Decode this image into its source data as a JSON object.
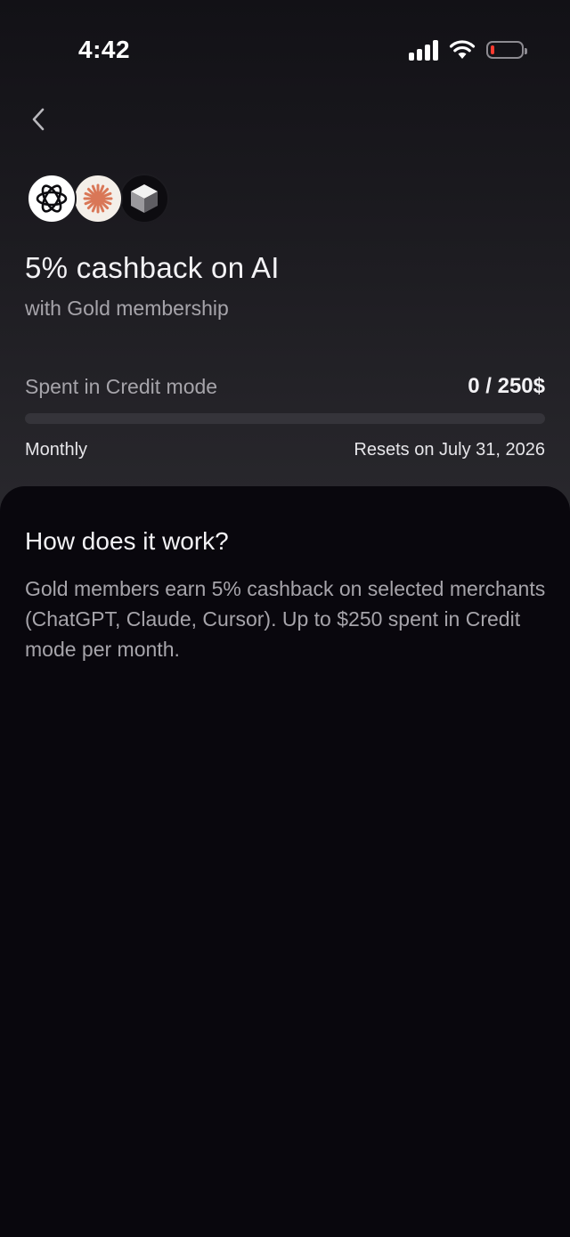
{
  "status_bar": {
    "time": "4:42",
    "signal_icon": "cellular-signal-icon",
    "wifi_icon": "wifi-icon",
    "battery_icon": "battery-low-icon",
    "battery_level": 0.1,
    "battery_color": "#ff3b30"
  },
  "nav": {
    "back_icon": "chevron-left-icon"
  },
  "merchant_logos": [
    {
      "name": "ChatGPT",
      "icon": "openai-logo-icon"
    },
    {
      "name": "Claude",
      "icon": "claude-logo-icon",
      "color": "#d97757"
    },
    {
      "name": "Cursor",
      "icon": "cursor-logo-icon"
    }
  ],
  "header": {
    "title": "5% cashback on AI",
    "subtitle": "with Gold membership"
  },
  "usage": {
    "label": "Spent in Credit mode",
    "value": "0 / 250$",
    "spent": 0,
    "limit": 250,
    "progress_fraction": 0,
    "period": "Monthly",
    "reset_text": "Resets on July 31, 2026"
  },
  "info": {
    "title": "How does it work?",
    "body": "Gold members earn 5% cashback on selected merchants (ChatGPT, Claude, Cursor). Up to $250 spent in Credit mode per month."
  },
  "colors": {
    "background": "#09070d",
    "text_primary": "#f3f2f5",
    "text_secondary": "#a6a4aa",
    "progress_track": "#35343a"
  }
}
